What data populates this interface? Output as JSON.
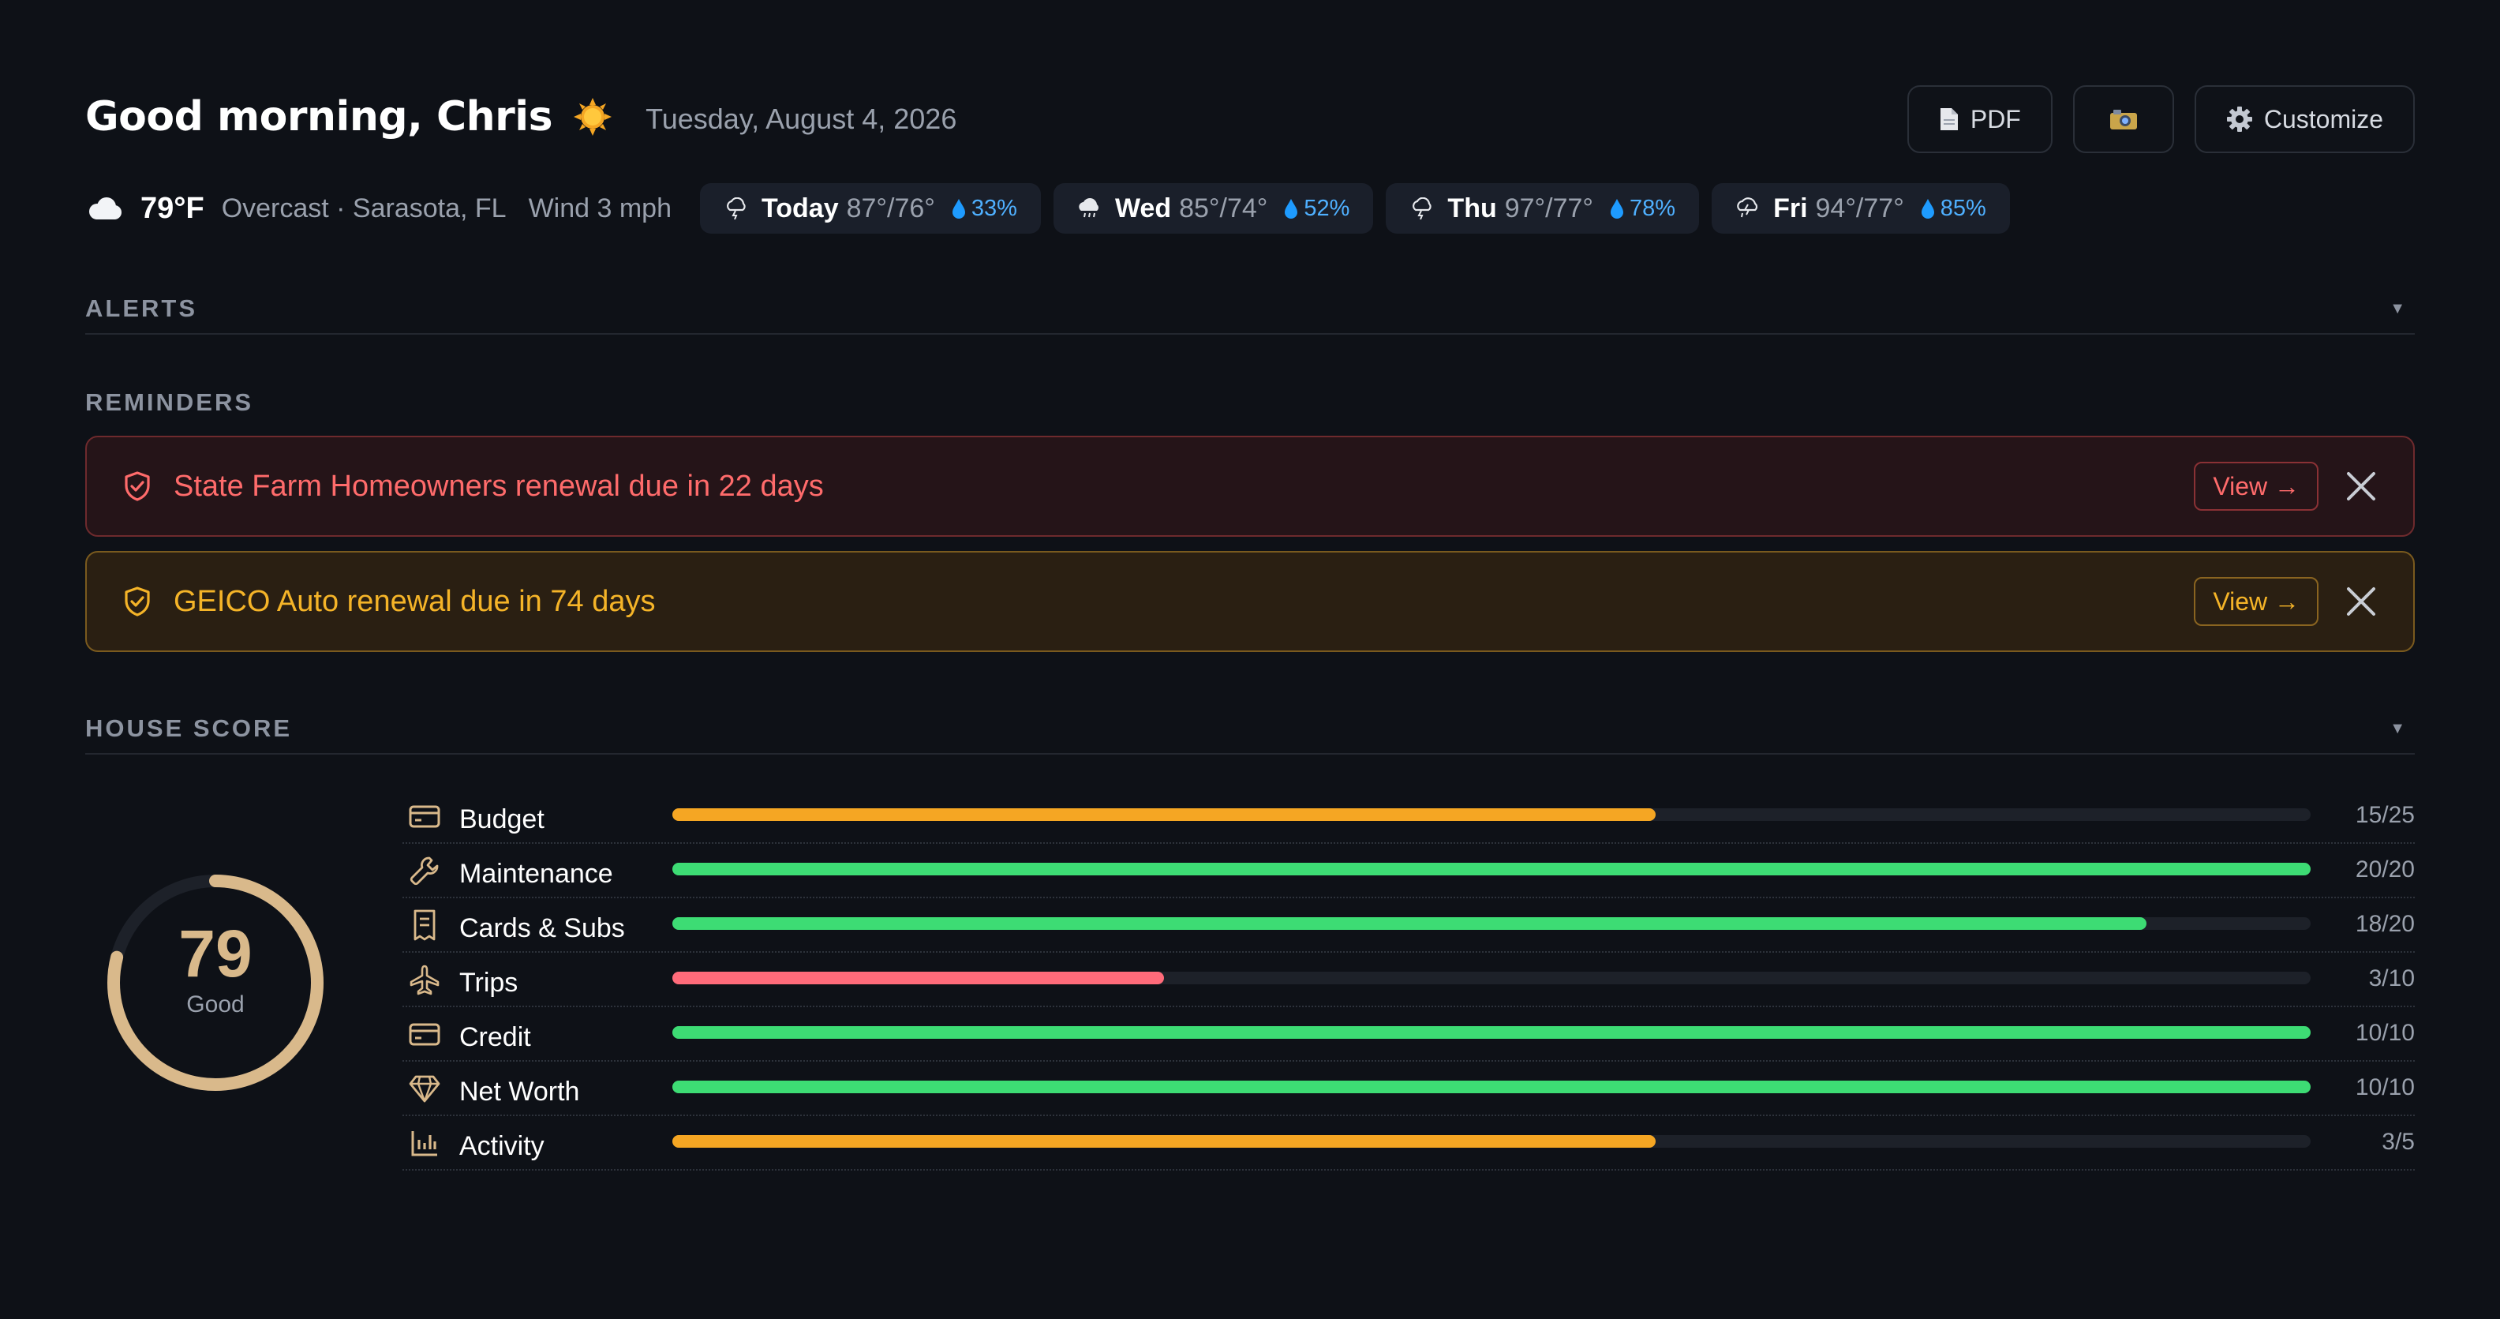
{
  "header": {
    "greeting": "Good morning, Chris",
    "date": "Tuesday, August 4, 2026",
    "actions": {
      "pdf_label": "PDF",
      "customize_label": "Customize"
    }
  },
  "weather": {
    "current_temp": "79°F",
    "conditions": "Overcast · Sarasota, FL",
    "wind": "Wind 3 mph",
    "forecast": [
      {
        "day": "Today",
        "temps": "87°/76°",
        "rain": "33%",
        "icon": "thunderstorm-icon"
      },
      {
        "day": "Wed",
        "temps": "85°/74°",
        "rain": "52%",
        "icon": "rain-icon"
      },
      {
        "day": "Thu",
        "temps": "97°/77°",
        "rain": "78%",
        "icon": "thunderstorm-icon"
      },
      {
        "day": "Fri",
        "temps": "94°/77°",
        "rain": "85%",
        "icon": "storm-icon"
      }
    ]
  },
  "sections": {
    "alerts": "ALERTS",
    "reminders": "REMINDERS",
    "house_score": "HOUSE SCORE"
  },
  "reminders": [
    {
      "text": "State Farm Homeowners renewal due in 22 days",
      "action": "View →",
      "severity": "red"
    },
    {
      "text": "GEICO Auto renewal due in 74 days",
      "action": "View →",
      "severity": "amber"
    }
  ],
  "house_score": {
    "score": "79",
    "score_value": 79,
    "rating": "Good",
    "ring_color": "#d9b98b",
    "categories": [
      {
        "name": "Budget",
        "value": "15/25",
        "fraction": 0.6,
        "color": "#f5a623",
        "icon": "wallet-icon"
      },
      {
        "name": "Maintenance",
        "value": "20/20",
        "fraction": 1.0,
        "color": "#3ddc74",
        "icon": "wrench-icon"
      },
      {
        "name": "Cards & Subs",
        "value": "18/20",
        "fraction": 0.9,
        "color": "#3ddc74",
        "icon": "receipt-icon"
      },
      {
        "name": "Trips",
        "value": "3/10",
        "fraction": 0.3,
        "color": "#ff6b7a",
        "icon": "plane-icon"
      },
      {
        "name": "Credit",
        "value": "10/10",
        "fraction": 1.0,
        "color": "#3ddc74",
        "icon": "credit-card-icon"
      },
      {
        "name": "Net Worth",
        "value": "10/10",
        "fraction": 1.0,
        "color": "#3ddc74",
        "icon": "diamond-icon"
      },
      {
        "name": "Activity",
        "value": "3/5",
        "fraction": 0.6,
        "color": "#f5a623",
        "icon": "bar-chart-icon"
      }
    ]
  }
}
